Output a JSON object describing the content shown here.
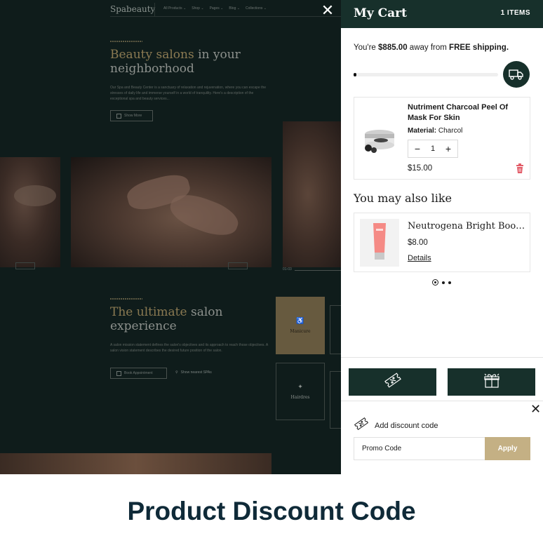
{
  "site": {
    "logo": "Spabeauty",
    "nav": [
      "All Products",
      "Shop",
      "Pages",
      "Blog",
      "Collections"
    ],
    "hero": {
      "title_gold": "Beauty salons",
      "title_rest": " in your neighborhood",
      "description": "Our Spa and Beauty Center is a sanctuary of relaxation and rejuvenation, where you can escape the stresses of daily life and immerse yourself in a world of tranquility. Here's a description of the exceptional spa and beauty services...",
      "button": "Show More"
    },
    "slider": {
      "counter": "01-03"
    },
    "section2": {
      "title_gold": "The ultimate",
      "title_rest": " salon experience",
      "description": "A salon mission statement defines the salon's objectives and its approach to reach those objectives. A salon vision statement describes the desired future position of the salon.",
      "book_button": "Book Appointment",
      "location_link": "Show nearest SPAs"
    },
    "tiles": [
      {
        "label": "Manicure",
        "icon": "polish-icon"
      },
      {
        "label": "Hairdres",
        "icon": "scissors-icon"
      }
    ]
  },
  "cart": {
    "title": "My Cart",
    "count": "1 ITEMS",
    "shipping": {
      "prefix": "You're ",
      "amount": "$885.00",
      "middle": " away from ",
      "free": "FREE shipping.",
      "progress": 0.02
    },
    "item": {
      "name": "Nutriment Charcoal Peel Of Mask For Skin",
      "attr_label": "Material:",
      "attr_value": " Charcol",
      "qty": "1",
      "price": "$15.00"
    },
    "recommend": {
      "title": "You may also like",
      "name": "Neutrogena Bright Boost...",
      "price": "$8.00",
      "link": "Details"
    },
    "discount": {
      "label": "Add discount code",
      "placeholder": "Promo Code",
      "apply": "Apply"
    }
  },
  "caption": "Product Discount Code",
  "colors": {
    "dark_green": "#17302b",
    "gold": "#c4b084",
    "caption": "#0f2a38"
  }
}
